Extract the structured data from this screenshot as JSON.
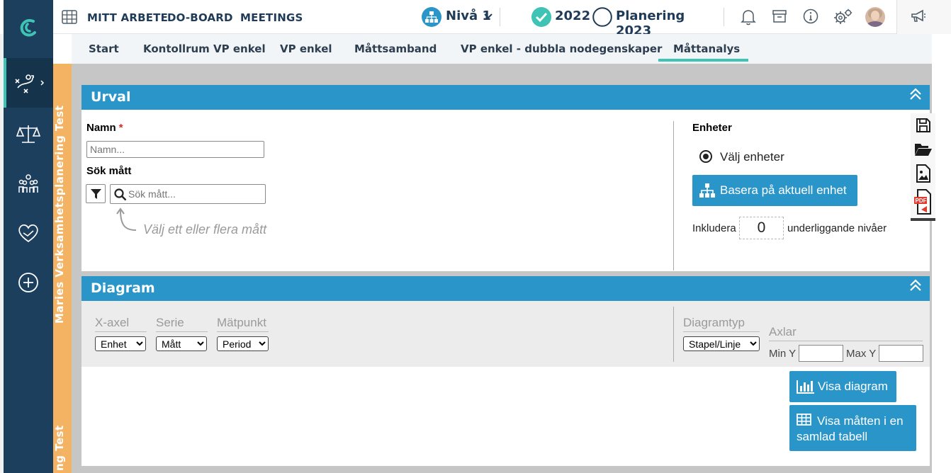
{
  "topnav": {
    "links": [
      "MITT ARBETE",
      "DO-BOARD",
      "MEETINGS"
    ],
    "level": "Nivå 1",
    "year": "2022",
    "plan": "Planering 2023"
  },
  "tabs": [
    "Start",
    "Kontollrum VP enkel",
    "VP enkel",
    "Måttsamband",
    "VP enkel - dubbla nodegenskaper",
    "Måttanalys"
  ],
  "vertical_label": "Maries Verksamhetsplanering Test",
  "vertical_label_bottom": "ng Test",
  "urval": {
    "title": "Urval",
    "name_label": "Namn",
    "required_mark": "*",
    "name_placeholder": "Namn...",
    "search_label": "Sök mått",
    "search_placeholder": "Sök mått...",
    "hint": "Välj ett eller flera mått",
    "units_label": "Enheter",
    "choose_units": "Välj enheter",
    "base_button": "Basera på aktuell enhet",
    "include_label": "Inkludera",
    "include_value": "0",
    "sublevels_label": "underliggande nivåer"
  },
  "diagram": {
    "title": "Diagram",
    "xaxis_label": "X-axel",
    "xaxis_value": "Enhet",
    "series_label": "Serie",
    "series_value": "Mått",
    "point_label": "Mätpunkt",
    "point_value": "Period",
    "type_label": "Diagramtyp",
    "type_value": "Stapel/Linje",
    "axes_label": "Axlar",
    "miny_label": "Min Y",
    "maxy_label": "Max Y",
    "show_chart_button": "Visa diagram",
    "show_table_button_line1": "Visa måtten i en",
    "show_table_button_line2": "samlad tabell"
  },
  "colors": {
    "sidebar": "#1d3f5e",
    "accent": "#3fc3b5",
    "panel_header": "#2a95c9",
    "vertical_strip": "#f4b263",
    "required": "#d52b2b"
  },
  "icons": [
    "logo-icon",
    "strategy-icon",
    "scales-icon",
    "people-icon",
    "heart-hand-icon",
    "plus-circle-icon",
    "grid-icon",
    "org-icon",
    "check-circle-icon",
    "circle-icon",
    "bell-icon",
    "archive-icon",
    "info-icon",
    "gears-icon",
    "avatar",
    "megaphone-icon",
    "save-icon",
    "folder-open-icon",
    "image-icon",
    "pdf-icon",
    "filter-icon",
    "search-icon",
    "radio-icon",
    "bar-chart-icon",
    "table-icon"
  ]
}
